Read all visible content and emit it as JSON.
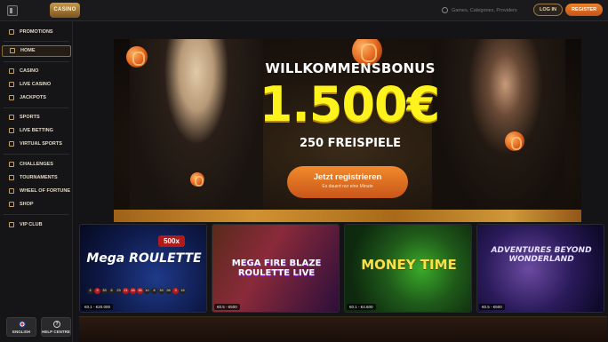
{
  "header": {
    "logo_text": "CASINO",
    "search_placeholder": "Games, Categories, Providers",
    "login_label": "LOG IN",
    "register_label": "REGISTER"
  },
  "sidebar": {
    "items": [
      {
        "label": "PROMOTIONS",
        "icon": "gift-icon"
      },
      {
        "label": "HOME",
        "icon": "home-icon",
        "active": true
      },
      {
        "label": "CASINO",
        "icon": "slot-icon"
      },
      {
        "label": "LIVE CASINO",
        "icon": "live-icon"
      },
      {
        "label": "JACKPOTS",
        "icon": "jackpot-icon"
      },
      {
        "label": "SPORTS",
        "icon": "ball-icon"
      },
      {
        "label": "LIVE BETTING",
        "icon": "live-bet-icon"
      },
      {
        "label": "VIRTUAL SPORTS",
        "icon": "virtual-icon"
      },
      {
        "label": "CHALLENGES",
        "icon": "trophy-icon"
      },
      {
        "label": "TOURNAMENTS",
        "icon": "cup-icon"
      },
      {
        "label": "WHEEL OF FORTUNE",
        "icon": "wheel-icon"
      },
      {
        "label": "SHOP",
        "icon": "shop-icon"
      },
      {
        "label": "VIP CLUB",
        "icon": "crown-icon"
      }
    ],
    "language_label": "ENGLISH",
    "help_label": "HELP CENTRE"
  },
  "hero": {
    "title": "WILLKOMMENSBONUS",
    "amount": "1.500€",
    "spins": "250 FREISPIELE",
    "cta_label": "Jetzt registrieren",
    "cta_sub": "Es dauert nur eine Minute"
  },
  "games": [
    {
      "title": "Mega ROULETTE",
      "multiplier": "500x",
      "limits": "€0.1 - €20.000",
      "numbers": [
        "4",
        "9",
        "33",
        "6",
        "23",
        "21",
        "18",
        "36",
        "10",
        "8",
        "33",
        "28",
        "3",
        "15"
      ]
    },
    {
      "title": "MEGA FIRE BLAZE ROULETTE LIVE",
      "limits": "€0.5 - €500"
    },
    {
      "title": "MONEY TIME",
      "limits": "€0.1 - €4.600"
    },
    {
      "title": "ADVENTURES BEYOND WONDERLAND",
      "limits": "€0.5 - €500"
    }
  ],
  "colors": {
    "accent_orange": "#e8702a",
    "gold_text": "#fff31e",
    "border_gold": "#8a6a3a"
  }
}
